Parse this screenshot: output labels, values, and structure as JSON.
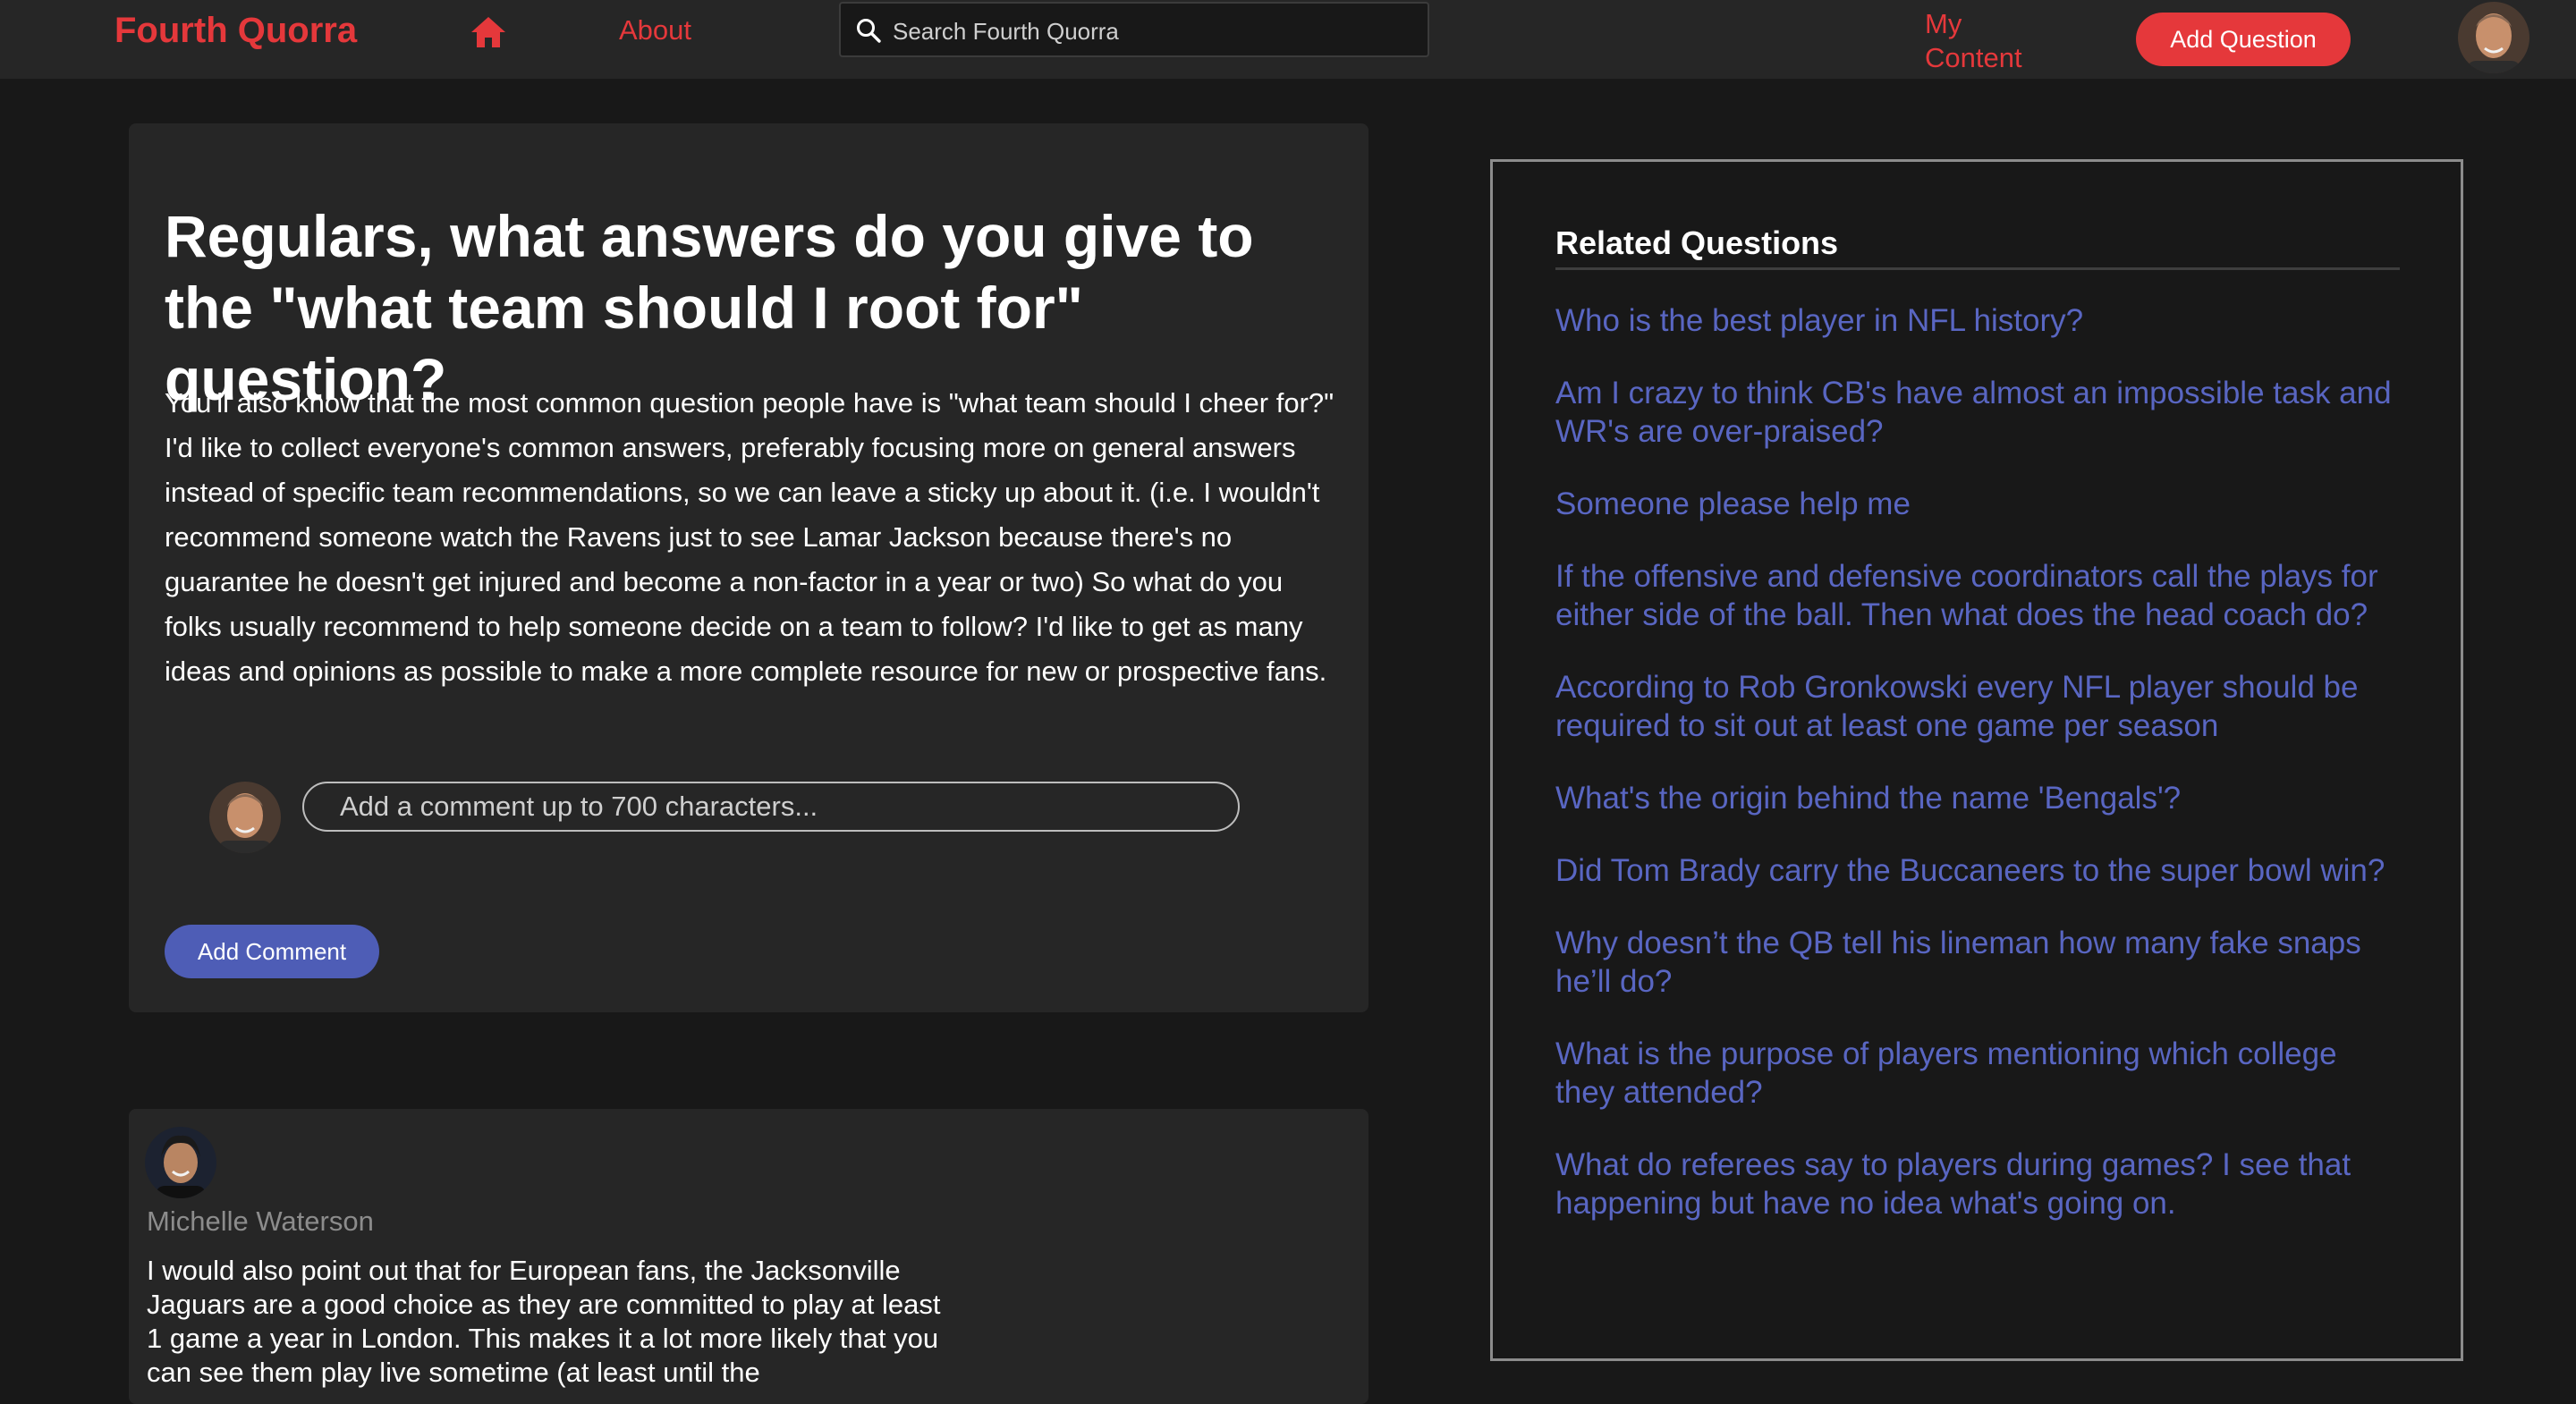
{
  "navbar": {
    "brand": "Fourth Quorra",
    "home_icon": "home-icon",
    "about": "About",
    "search": {
      "placeholder": "Search Fourth Quorra",
      "icon": "search-icon"
    },
    "my_content": "My Content",
    "add_question": "Add Question",
    "avatar": "user-avatar"
  },
  "question": {
    "title": "Regulars, what answers do you give to the \"what team should I root for\" question?",
    "body": "You'll also know that the most common question people have is \"what team should I cheer for?\" I'd like to collect everyone's common answers, preferably focusing more on general answers instead of specific team recommendations, so we can leave a sticky up about it. (i.e. I wouldn't recommend someone watch the Ravens just to see Lamar Jackson because there's no guarantee he doesn't get injured and become a non-factor in a year or two) So what do you folks usually recommend to help someone decide on a team to follow? I'd like to get as many ideas and opinions as possible to make a more complete resource for new or prospective fans.",
    "comment_placeholder": "Add a comment up to 700 characters...",
    "add_comment": "Add Comment"
  },
  "answer": {
    "author": "Michelle Waterson",
    "text": "I would also point out that for European fans, the Jacksonville Jaguars are a good choice as they are committed to play at least 1 game a year in London. This makes it a lot more likely that you can see them play live sometime (at least until the"
  },
  "related": {
    "heading": "Related Questions",
    "items": [
      "Who is the best player in NFL history?",
      "Am I crazy to think CB's have almost an impossible task and WR's are over-praised?",
      "Someone please help me",
      "If the offensive and defensive coordinators call the plays for either side of the ball. Then what does the head coach do?",
      "According to Rob Gronkowski every NFL player should be required to sit out at least one game per season",
      "What's the origin behind the name 'Bengals'?",
      "Did Tom Brady carry the Buccaneers to the super bowl win?",
      "Why doesn’t the QB tell his lineman how many fake snaps he’ll do?",
      "What is the purpose of players mentioning which college they attended?",
      "What do referees say to players during games? I see that happening but have no idea what's going on."
    ]
  },
  "colors": {
    "brand_red": "#e5383b",
    "link_blue": "#5966c2",
    "button_blue": "#4e5db6",
    "card_bg": "#262626",
    "page_bg": "#181818"
  }
}
